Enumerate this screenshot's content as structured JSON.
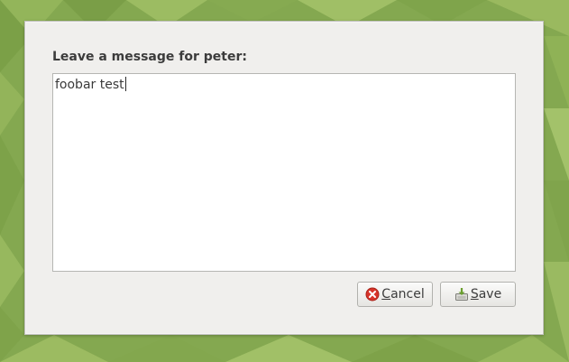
{
  "dialog": {
    "prompt": "Leave a message for peter:",
    "message": "foobar test",
    "buttons": {
      "cancel": {
        "mnemonic": "C",
        "rest": "ancel",
        "icon": "cancel-icon"
      },
      "save": {
        "mnemonic": "S",
        "rest": "ave",
        "icon": "save-icon"
      }
    }
  },
  "colors": {
    "dialog_bg": "#f0efed",
    "desktop_green": "#84a850",
    "cancel_icon_red": "#d7342a",
    "save_icon_green": "#6a9f2e"
  }
}
